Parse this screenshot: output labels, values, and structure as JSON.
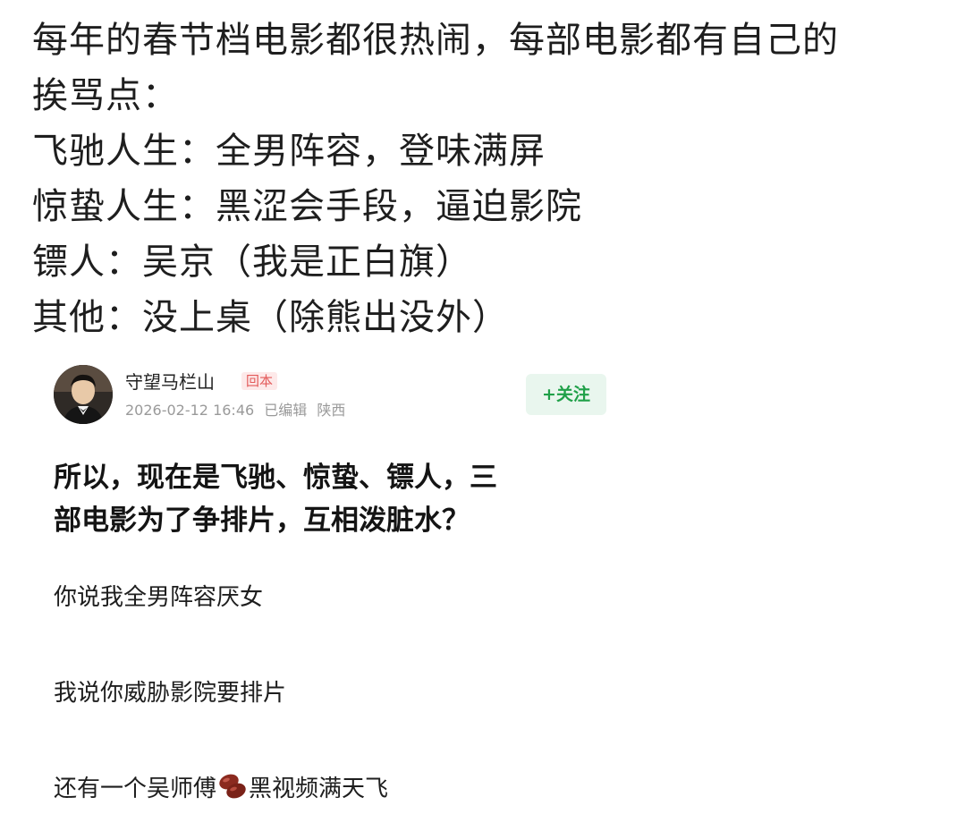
{
  "top_text": {
    "lines": [
      "每年的春节档电影都很热闹，每部电影都有自己的",
      "挨骂点：",
      "飞驰人生：全男阵容，登味满屏",
      "惊蛰人生：黑涩会手段，逼迫影院",
      "镖人：吴京（我是正白旗）",
      "其他：没上桌（除熊出没外）"
    ]
  },
  "post": {
    "author": {
      "name": "守望马栏山",
      "badge": "回本",
      "date": "2026-02-12 16:46",
      "edited": "已编辑",
      "location": "陕西"
    },
    "follow_label": "+关注",
    "title_lines": [
      "所以，现在是飞驰、惊蛰、镖人，三",
      "部电影为了争排片，互相泼脏水？"
    ],
    "paragraphs": [
      "你说我全男阵容厌女",
      "我说你威胁影院要排片"
    ],
    "last_paragraph": {
      "before": "还有一个吴师傅",
      "emoji": "bean-emoji",
      "after": "黑视频满天飞"
    }
  },
  "colors": {
    "follow_green": "#1fa048",
    "follow_bg": "#e9f6ee",
    "badge_red": "#e35a5a",
    "badge_bg": "#fde9e9",
    "meta_gray": "#9a9a9a"
  }
}
